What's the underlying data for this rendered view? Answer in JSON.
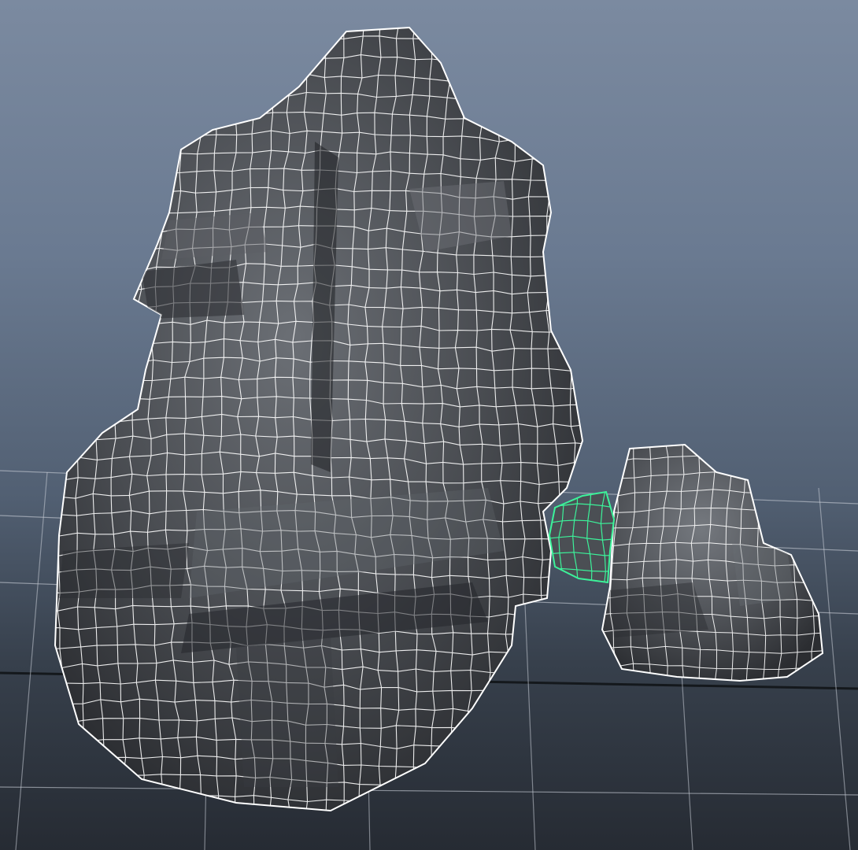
{
  "viewport": {
    "kind": "3d-modeling-viewport",
    "background_top": "#7b8aa0",
    "background_bottom": "#262b33",
    "grid_color": "#c8cdd6",
    "wireframe_color": "#ffffff",
    "selection_color": "#3cf29a",
    "mesh_color": "#4a4d52"
  },
  "objects": [
    {
      "name": "large-rock-mesh",
      "selected": false
    },
    {
      "name": "small-rock-mesh",
      "selected": false
    },
    {
      "name": "pebble-mesh",
      "selected": true
    }
  ]
}
